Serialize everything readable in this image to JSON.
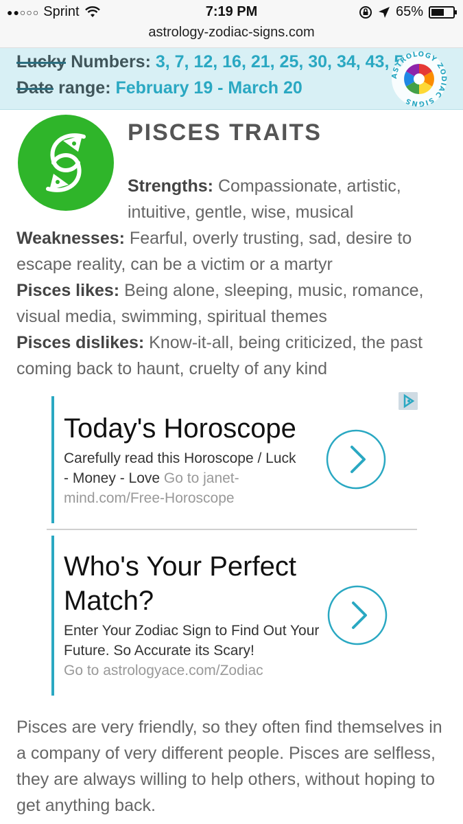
{
  "status_bar": {
    "signal": "●●○○○",
    "carrier": "Sprint",
    "time": "7:19 PM",
    "battery_percent": "65%",
    "battery_level": 0.65
  },
  "browser": {
    "url": "astrology-zodiac-signs.com"
  },
  "banner": {
    "lucky_label_prefix": "Lucky",
    "lucky_label_suffix": " Numbers: ",
    "lucky_numbers": "3, 7, 12, 16, 21, 25, 30, 34, 43, 5",
    "date_label_prefix": "Date",
    "date_label_suffix": " range: ",
    "date_range": "February 19 - March 20"
  },
  "logo": {
    "ring_text": "ASTROLOGY ZODIAC SIGNS"
  },
  "traits": {
    "title": "PISCES TRAITS",
    "strengths_label": "Strengths:",
    "strengths_text": " Compassionate, artistic, intuitive, gentle, wise, musical",
    "weaknesses_label": "Weaknesses:",
    "weaknesses_text": " Fearful, overly trusting, sad, desire to escape reality, can be a victim or a martyr",
    "likes_label": "Pisces likes:",
    "likes_text": " Being alone, sleeping, music, romance, visual media, swimming, spiritual themes",
    "dislikes_label": "Pisces dislikes:",
    "dislikes_text": " Know-it-all, being criticized, the past coming back to haunt, cruelty of any kind"
  },
  "ads": [
    {
      "title": "Today's Horoscope",
      "desc": "Carefully read this Horoscope / Luck - Money - Love",
      "go": " Go to janet-mind.com/Free-Horoscope"
    },
    {
      "title": "Who's Your Perfect Match?",
      "desc": "Enter Your Zodiac Sign to Find Out Your Future. So Accurate its Scary!",
      "go": "Go to astrologyace.com/Zodiac"
    }
  ],
  "article": {
    "paragraph": "Pisces are very friendly, so they often find themselves in a company of very different people. Pisces are selfless, they are always willing to help others, without hoping to get anything back."
  },
  "colors": {
    "accent": "#2aa8c2",
    "banner_bg": "#d8f0f5",
    "pisces_green": "#2fb52a"
  }
}
